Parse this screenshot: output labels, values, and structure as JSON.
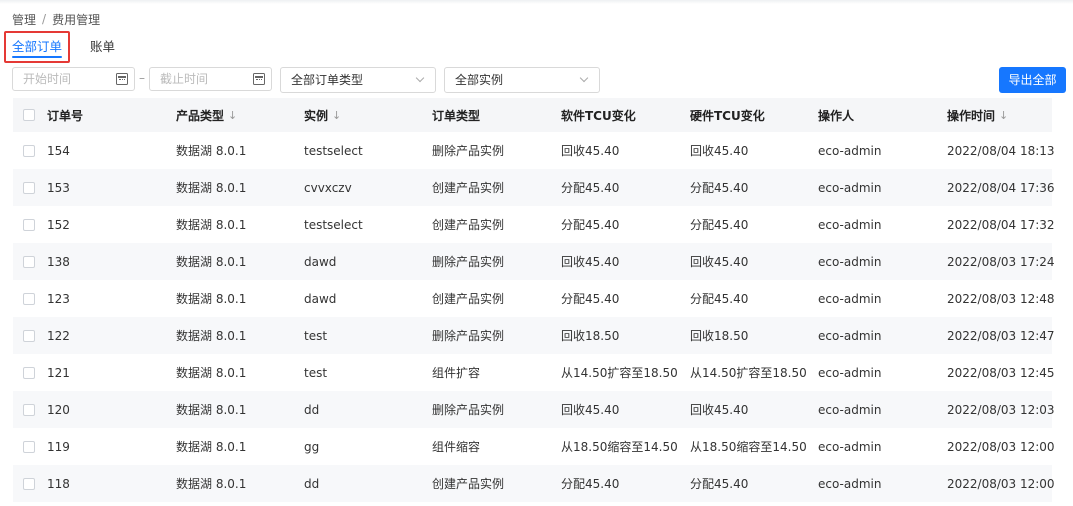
{
  "breadcrumb": {
    "items": [
      "管理",
      "费用管理"
    ],
    "separator": "/"
  },
  "tabs": [
    {
      "label": "全部订单",
      "active": true
    },
    {
      "label": "账单",
      "active": false
    }
  ],
  "filters": {
    "start_placeholder": "开始时间",
    "range_separator": "–",
    "end_placeholder": "截止时间",
    "order_type": "全部订单类型",
    "instance": "全部实例",
    "export_label": "导出全部"
  },
  "colors": {
    "accent": "#1677ff",
    "highlight_border": "#e53935",
    "header_bg": "#f5f6f8",
    "stripe_bg": "#f7f8fa"
  },
  "table": {
    "columns": [
      "订单号",
      "产品类型",
      "实例",
      "订单类型",
      "软件TCU变化",
      "硬件TCU变化",
      "操作人",
      "操作时间"
    ],
    "sort_icon": "↓",
    "sortable_columns": [
      "产品类型",
      "实例",
      "操作时间"
    ],
    "rows": [
      [
        "154",
        "数据湖 8.0.1",
        "testselect",
        "删除产品实例",
        "回收45.40",
        "回收45.40",
        "eco-admin",
        "2022/08/04 18:13"
      ],
      [
        "153",
        "数据湖 8.0.1",
        "cvvxczv",
        "创建产品实例",
        "分配45.40",
        "分配45.40",
        "eco-admin",
        "2022/08/04 17:36"
      ],
      [
        "152",
        "数据湖 8.0.1",
        "testselect",
        "创建产品实例",
        "分配45.40",
        "分配45.40",
        "eco-admin",
        "2022/08/04 17:32"
      ],
      [
        "138",
        "数据湖 8.0.1",
        "dawd",
        "删除产品实例",
        "回收45.40",
        "回收45.40",
        "eco-admin",
        "2022/08/03 17:24"
      ],
      [
        "123",
        "数据湖 8.0.1",
        "dawd",
        "创建产品实例",
        "分配45.40",
        "分配45.40",
        "eco-admin",
        "2022/08/03 12:48"
      ],
      [
        "122",
        "数据湖 8.0.1",
        "test",
        "删除产品实例",
        "回收18.50",
        "回收18.50",
        "eco-admin",
        "2022/08/03 12:47"
      ],
      [
        "121",
        "数据湖 8.0.1",
        "test",
        "组件扩容",
        "从14.50扩容至18.50",
        "从14.50扩容至18.50",
        "eco-admin",
        "2022/08/03 12:45"
      ],
      [
        "120",
        "数据湖 8.0.1",
        "dd",
        "删除产品实例",
        "回收45.40",
        "回收45.40",
        "eco-admin",
        "2022/08/03 12:03"
      ],
      [
        "119",
        "数据湖 8.0.1",
        "gg",
        "组件缩容",
        "从18.50缩容至14.50",
        "从18.50缩容至14.50",
        "eco-admin",
        "2022/08/03 12:00"
      ],
      [
        "118",
        "数据湖 8.0.1",
        "dd",
        "创建产品实例",
        "分配45.40",
        "分配45.40",
        "eco-admin",
        "2022/08/03 12:00"
      ]
    ]
  }
}
